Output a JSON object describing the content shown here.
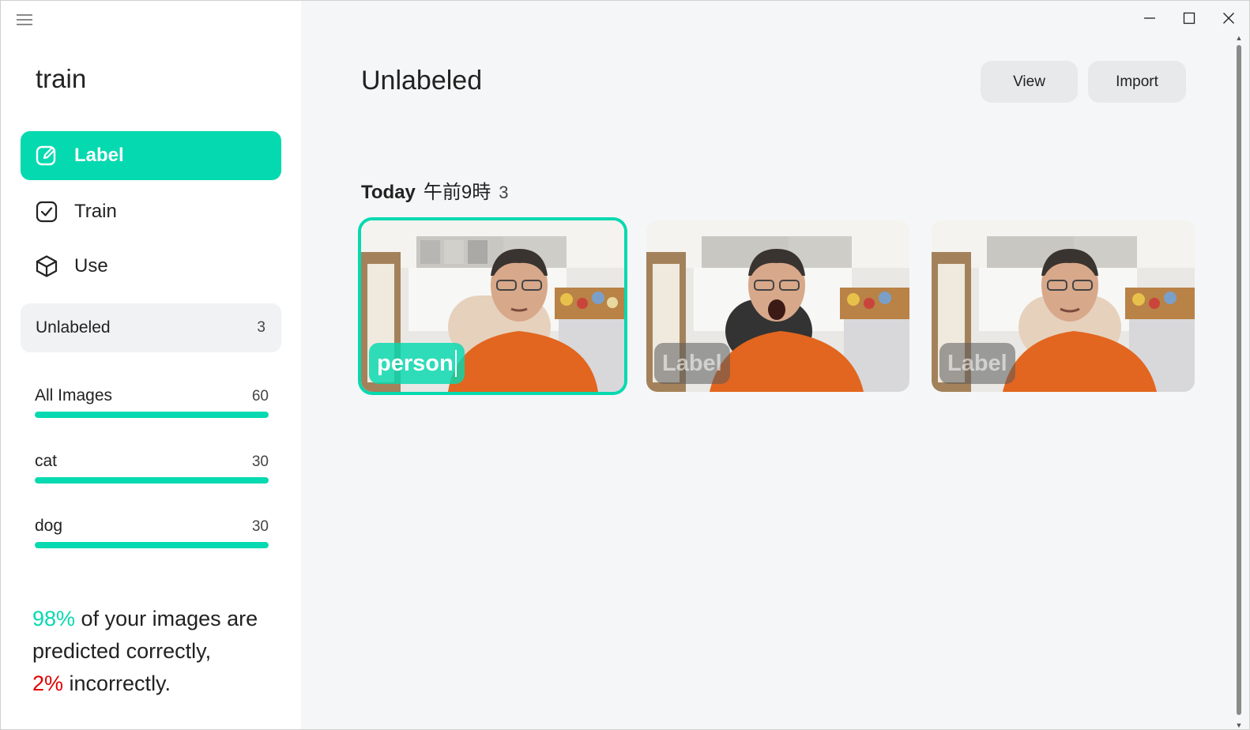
{
  "app": {
    "title": "train"
  },
  "nav": {
    "label": "Label",
    "train": "Train",
    "use": "Use"
  },
  "unlabeled": {
    "label": "Unlabeled",
    "count": "3"
  },
  "categories": [
    {
      "name": "All Images",
      "count": "60",
      "fill": 1.0
    },
    {
      "name": "cat",
      "count": "30",
      "fill": 1.0
    },
    {
      "name": "dog",
      "count": "30",
      "fill": 1.0
    }
  ],
  "summary": {
    "correct_pct": "98%",
    "correct_text": " of your images are predicted correctly,",
    "incorrect_pct": "2%",
    "incorrect_text": " incorrectly."
  },
  "main": {
    "title": "Unlabeled",
    "view_button": "View",
    "import_button": "Import"
  },
  "group": {
    "date": "Today",
    "time": "午前9時",
    "count": "3"
  },
  "images": [
    {
      "label": "person",
      "selected": true
    },
    {
      "label": "Label",
      "selected": false
    },
    {
      "label": "Label",
      "selected": false
    }
  ],
  "colors": {
    "accent": "#05d9b0",
    "error": "#e00000"
  },
  "icons": {
    "menu": "hamburger-icon",
    "label": "edit-icon",
    "train": "checkbox-icon",
    "use": "cube-icon",
    "minimize": "minimize-icon",
    "maximize": "maximize-icon",
    "close": "close-icon"
  }
}
